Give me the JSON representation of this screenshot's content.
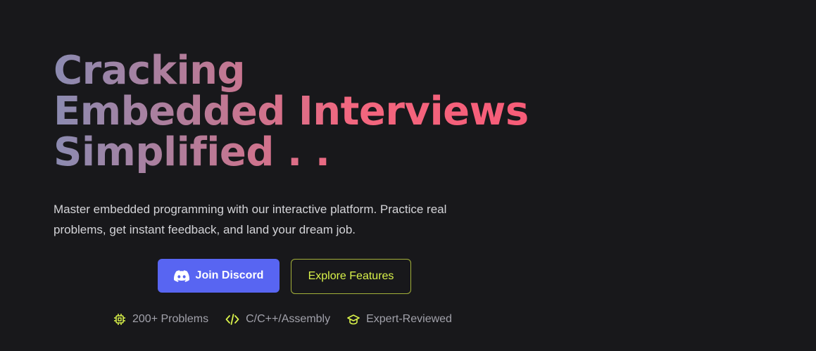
{
  "hero": {
    "title_lines": [
      "Cracking",
      "Embedded Interviews",
      "Simplified . ."
    ],
    "description": "Master embedded programming with our interactive platform. Practice real problems, get instant feedback, and land your dream job."
  },
  "buttons": {
    "discord_label": "Join Discord",
    "explore_label": "Explore Features"
  },
  "features": [
    {
      "icon": "chip-icon",
      "label": "200+ Problems"
    },
    {
      "icon": "code-icon",
      "label": "C/C++/Assembly"
    },
    {
      "icon": "graduation-cap-icon",
      "label": "Expert-Reviewed"
    }
  ],
  "colors": {
    "background": "#18181b",
    "gradient_start": "#8b8bb1",
    "gradient_end": "#f75c78",
    "discord": "#5865f2",
    "accent": "#d9f24a",
    "text_muted": "#a1a1aa"
  }
}
